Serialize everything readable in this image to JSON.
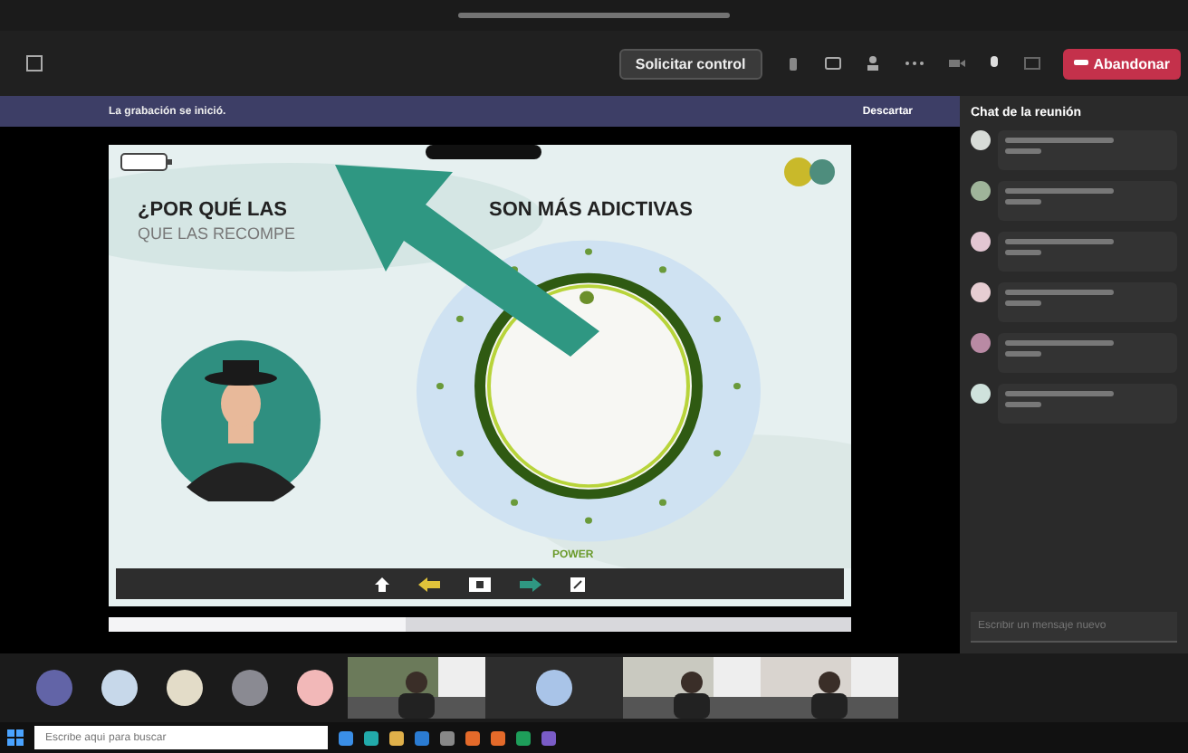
{
  "toolbar": {
    "request_control": "Solicitar control",
    "leave": "Abandonar"
  },
  "banner": {
    "message": "La grabación se inició.",
    "dismiss": "Descartar"
  },
  "slide": {
    "title_left": "¿POR QUÉ LAS",
    "title_right": "SON MÁS ADICTIVAS",
    "subtitle": "QUE LAS RECOMPE",
    "dial_label": "POWER"
  },
  "chat": {
    "title": "Chat de la reunión",
    "placeholder": "Escribir un mensaje nuevo",
    "messages": [
      {
        "color": "#d8dcd8"
      },
      {
        "color": "#9fb49a"
      },
      {
        "color": "#e2c6d2"
      },
      {
        "color": "#e6cdd2"
      },
      {
        "color": "#b98aa4"
      },
      {
        "color": "#cfe2dc"
      }
    ]
  },
  "participants": [
    {
      "kind": "avatar",
      "color": "#6264a7"
    },
    {
      "kind": "avatar",
      "color": "#c7d8ea"
    },
    {
      "kind": "avatar",
      "color": "#e3dcc8"
    },
    {
      "kind": "avatar",
      "color": "#8a8a92"
    },
    {
      "kind": "avatar",
      "color": "#f2b8b8"
    },
    {
      "kind": "video"
    },
    {
      "kind": "tile",
      "color": "#a9c4e8"
    },
    {
      "kind": "video"
    },
    {
      "kind": "video"
    }
  ],
  "playback": {
    "level": 0.4
  },
  "taskbar": {
    "search_placeholder": "Escribe aquí para buscar"
  }
}
